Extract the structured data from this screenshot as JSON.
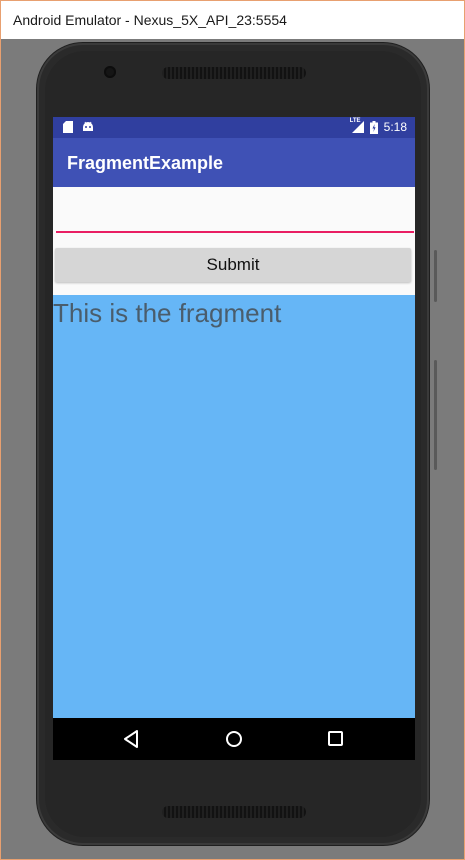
{
  "window": {
    "title": "Android Emulator - Nexus_5X_API_23:5554"
  },
  "statusbar": {
    "left_icons": [
      "sd-card-icon",
      "android-icon"
    ],
    "network_label": "LTE",
    "time": "5:18"
  },
  "app": {
    "title": "FragmentExample"
  },
  "form": {
    "input_value": "",
    "submit_label": "Submit"
  },
  "fragment": {
    "text": "This is the fragment"
  },
  "navbar": {
    "icons": [
      "back-icon",
      "home-icon",
      "recent-apps-icon"
    ]
  },
  "colors": {
    "status_bar": "#303f9f",
    "app_bar": "#3f51b5",
    "fragment_bg": "#66b6f6",
    "input_underline": "#e91e63"
  }
}
